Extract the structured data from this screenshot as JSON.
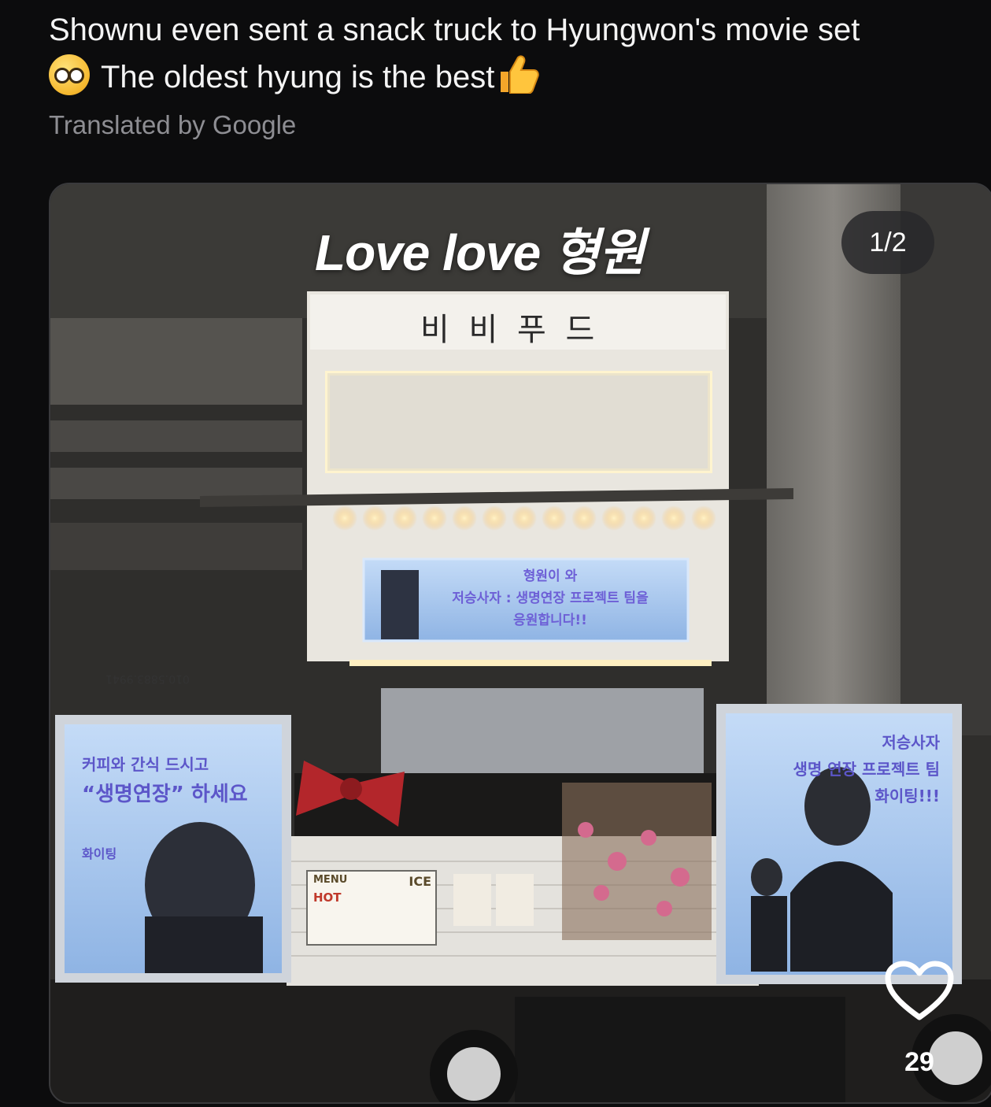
{
  "post": {
    "caption_line1": "Shownu even sent a snack truck to Hyungwon's movie set",
    "caption_line2": "The oldest hyung is the best",
    "translated_label": "Translated by Google",
    "icons": [
      "pleading-face-emoji",
      "thumbs-up-emoji"
    ]
  },
  "media": {
    "counter": "1/2",
    "overlay_title": "Love love 형원",
    "truck_sign": "비 비 푸 드",
    "phone_number": "010.5883.9941",
    "center_banner": {
      "line1": "형원이 와",
      "line2": "저승사자 : 생명연장 프로젝트 팀을",
      "line3": "응원합니다!!"
    },
    "left_poster": {
      "line1": "커피와 간식 드시고",
      "line2": "“생명연장” 하세요",
      "line3": "화이팅"
    },
    "right_poster": {
      "line1": "저승사자",
      "line2": "생명 연장 프로젝트 팀",
      "line3": "화이팅!!!"
    },
    "menu_board": {
      "menu_label": "MENU",
      "hot_label": "HOT",
      "ice_label": "ICE"
    }
  },
  "reactions": {
    "like_icon": "heart-outline-icon",
    "like_count": "29"
  },
  "colors": {
    "background": "#0c0c0d",
    "secondary_text": "#8e8e93",
    "poster_blue": "#a9c8ee",
    "light_glow": "#ffd36b"
  }
}
